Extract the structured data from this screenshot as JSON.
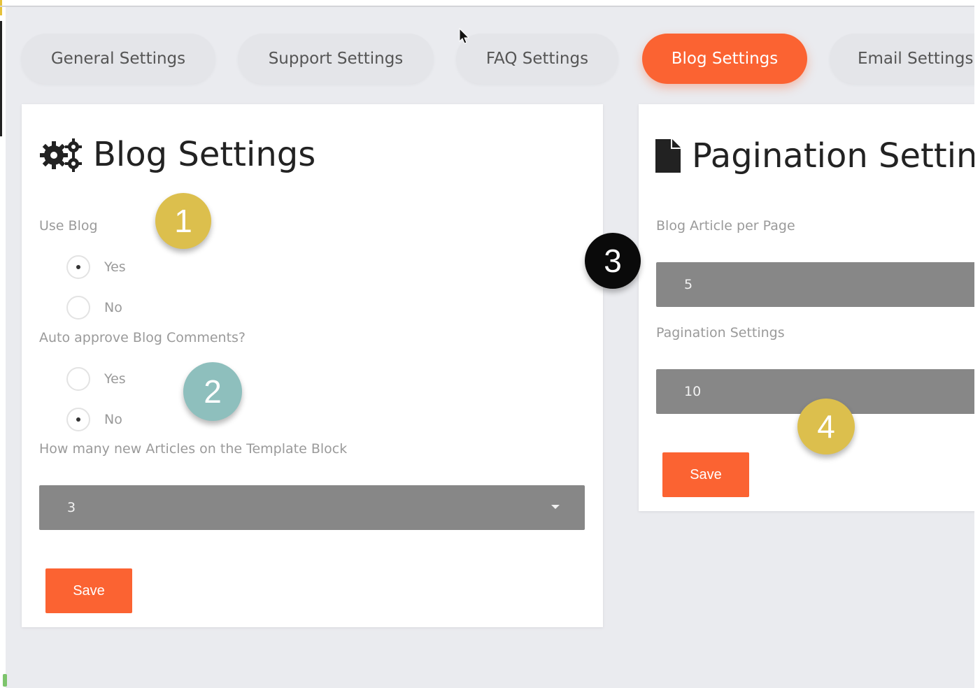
{
  "tabs": [
    {
      "label": "General Settings"
    },
    {
      "label": "Support Settings"
    },
    {
      "label": "FAQ Settings"
    },
    {
      "label": "Blog Settings",
      "active": true
    },
    {
      "label": "Email Settings"
    }
  ],
  "blog_card": {
    "title": "Blog Settings",
    "icon": "gears-icon",
    "use_blog": {
      "label": "Use Blog",
      "options": [
        "Yes",
        "No"
      ],
      "selected": "Yes"
    },
    "auto_approve": {
      "label": "Auto approve Blog Comments?",
      "options": [
        "Yes",
        "No"
      ],
      "selected": "No"
    },
    "articles_on_block": {
      "label": "How many new Articles on the Template Block",
      "value": "3"
    },
    "save_label": "Save"
  },
  "pagination_card": {
    "title": "Pagination Settings",
    "icon": "file-icon",
    "article_per_page": {
      "label": "Blog Article per Page",
      "value": "5"
    },
    "pagination_settings": {
      "label": "Pagination Settings",
      "value": "10"
    },
    "save_label": "Save"
  },
  "badges": [
    {
      "number": "1",
      "color": "#dcbf4d"
    },
    {
      "number": "2",
      "color": "#8ebfbd"
    },
    {
      "number": "3",
      "color": "#0a0a0a"
    },
    {
      "number": "4",
      "color": "#dcbf4d"
    }
  ],
  "colors": {
    "accent": "#fb6332",
    "field": "#878787",
    "background": "#eaebef"
  }
}
